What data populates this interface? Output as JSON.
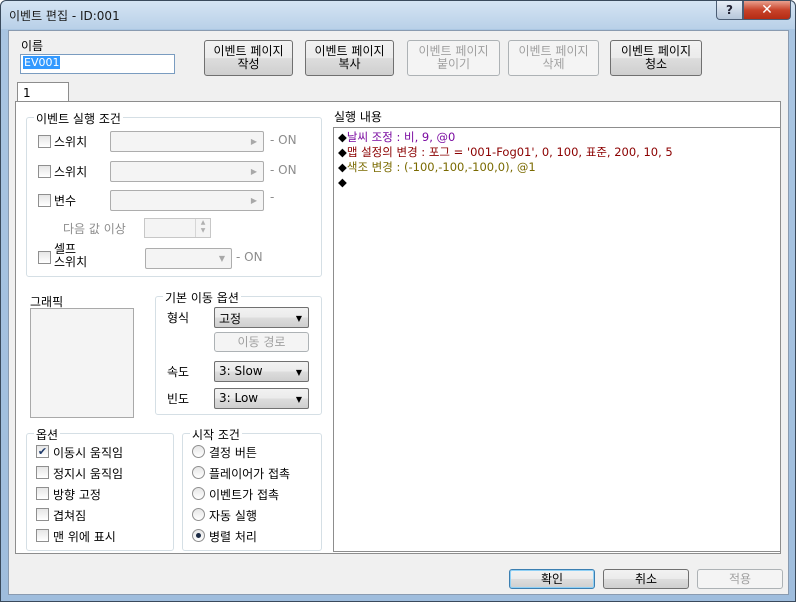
{
  "window": {
    "title": "이벤트 편집 - ID:001",
    "help_label": "?",
    "close_label": "✕"
  },
  "name": {
    "label": "이름",
    "value": "EV001"
  },
  "page_buttons": {
    "create": [
      "이벤트 페이지",
      "작성"
    ],
    "copy": [
      "이벤트 페이지",
      "복사"
    ],
    "paste": [
      "이벤트 페이지",
      "붙이기"
    ],
    "delete": [
      "이벤트 페이지",
      "삭제"
    ],
    "clear": [
      "이벤트 페이지",
      "청소"
    ]
  },
  "tab": {
    "label": "1"
  },
  "conditions": {
    "title": "이벤트 실행 조건",
    "switch1": {
      "label": "스위치",
      "suffix": "- ON"
    },
    "switch2": {
      "label": "스위치",
      "suffix": "- ON"
    },
    "variable": {
      "label": "변수",
      "suffix": "-"
    },
    "variable_compare": "다음 값 이상",
    "self_switch": {
      "label": [
        "셀프",
        "스위치"
      ],
      "suffix": "- ON"
    }
  },
  "graphic": {
    "label": "그래픽"
  },
  "movement": {
    "title": "기본 이동 옵션",
    "type_label": "형식",
    "type_value": "고정",
    "route_button": "이동 경로",
    "speed_label": "속도",
    "speed_value": "3: Slow",
    "freq_label": "빈도",
    "freq_value": "3: Low"
  },
  "options": {
    "title": "옵션",
    "items": [
      {
        "label": "이동시 움직임",
        "checked": true
      },
      {
        "label": "정지시 움직임",
        "checked": false
      },
      {
        "label": "방향 고정",
        "checked": false
      },
      {
        "label": "겹쳐짐",
        "checked": false
      },
      {
        "label": "맨 위에 표시",
        "checked": false
      }
    ]
  },
  "trigger": {
    "title": "시작 조건",
    "items": [
      {
        "label": "결정 버튼",
        "selected": false
      },
      {
        "label": "플레이어가 접촉",
        "selected": false
      },
      {
        "label": "이벤트가 접촉",
        "selected": false
      },
      {
        "label": "자동 실행",
        "selected": false
      },
      {
        "label": "병렬 처리",
        "selected": true
      }
    ]
  },
  "script": {
    "label": "실행 내용",
    "lines": [
      {
        "marker": "◆",
        "text": "날씨 조정 : 비, 9, @0"
      },
      {
        "marker": "◆",
        "text": "맵 설정의 변경 : 포그 = '001-Fog01', 0, 100, 표준, 200, 10, 5"
      },
      {
        "marker": "◆",
        "text": "색조 변경 : (-100,-100,-100,0), @1"
      },
      {
        "marker": "◆",
        "text": ""
      }
    ]
  },
  "footer": {
    "ok": "확인",
    "cancel": "취소",
    "apply": "적용"
  },
  "colors": {
    "weather_cmd": "#7a0aa0",
    "map_cmd": "#8b0000",
    "color_cmd": "#7a6a00",
    "selection": "#3399ff"
  }
}
